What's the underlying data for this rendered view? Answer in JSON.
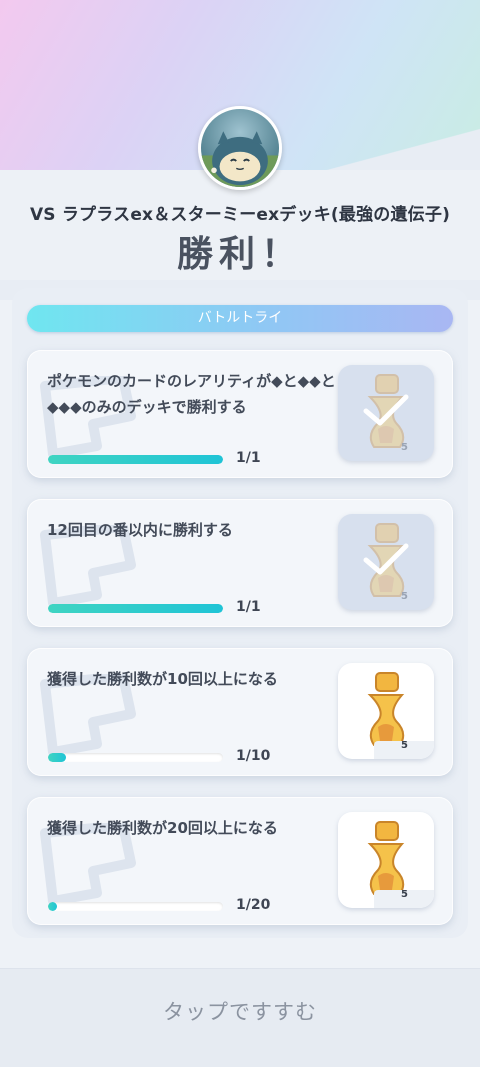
{
  "header": {
    "opponent_line": "VS ラプラスex＆スターミーexデッキ(最強の遺伝子)",
    "result": "勝利！",
    "avatar_icon": "snorlax-avatar-icon"
  },
  "section": {
    "tab_label": "バトルトライ"
  },
  "missions": [
    {
      "text": "ポケモンのカードのレアリティが◆と◆◆と◆◆◆のみのデッキで勝利する",
      "progress_label": "1/1",
      "progress": 1.0,
      "reward_count": "5",
      "reward_icon": "hourglass-item-icon",
      "completed": true
    },
    {
      "text": "12回目の番以内に勝利する",
      "progress_label": "1/1",
      "progress": 1.0,
      "reward_count": "5",
      "reward_icon": "hourglass-item-icon",
      "completed": true
    },
    {
      "text": "獲得した勝利数が10回以上になる",
      "progress_label": "1/10",
      "progress": 0.1,
      "reward_count": "5",
      "reward_icon": "hourglass-item-icon",
      "completed": false
    },
    {
      "text": "獲得した勝利数が20回以上になる",
      "progress_label": "1/20",
      "progress": 0.05,
      "reward_count": "5",
      "reward_icon": "hourglass-item-icon",
      "completed": false
    }
  ],
  "footer": {
    "label": "タップですすむ"
  },
  "colors": {
    "accent": "#1fc4d6",
    "tab_gradient_start": "#6fe6f0",
    "tab_gradient_end": "#a9b7f3",
    "reward_gold": "#f2b640"
  }
}
